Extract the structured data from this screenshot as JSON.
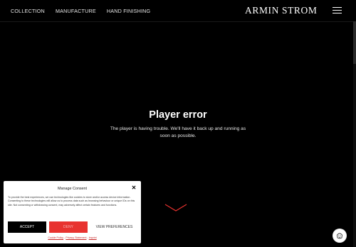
{
  "header": {
    "nav": [
      {
        "label": "COLLECTION"
      },
      {
        "label": "MANUFACTURE"
      },
      {
        "label": "HAND FINISHING"
      }
    ],
    "logo": "ARMIN STROM",
    "menu_icon": "hamburger-menu-icon"
  },
  "player": {
    "title": "Player error",
    "message": "The player is having trouble. We'll have it back up and running as soon as possible."
  },
  "scroll_icon": "chevron-down-icon",
  "consent": {
    "title": "Manage Consent",
    "close_icon": "close-icon",
    "text": "To provide the best experiences, we use technologies like cookies to store and/or access device information. Consenting to these technologies will allow us to process data such as browsing behaviour or unique IDs on this site. Not consenting or withdrawing consent, may adversely affect certain features and functions.",
    "accept_label": "ACCEPT",
    "deny_label": "DENY",
    "preferences_label": "VIEW PREFERENCES",
    "links": {
      "cookie_policy": "Cookie Policy",
      "privacy": "Privacy Statement",
      "imprint": "Imprint",
      "separator": " - "
    },
    "colors": {
      "accept_bg": "#000000",
      "deny_bg": "#e8322f",
      "link": "#c62424"
    }
  },
  "cookie_badge_icon": "cookie-settings-icon"
}
